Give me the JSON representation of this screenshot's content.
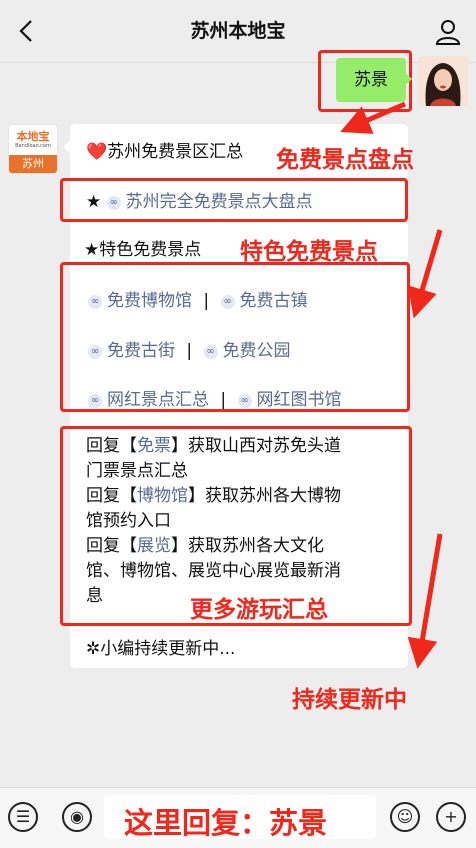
{
  "header": {
    "title": "苏州本地宝"
  },
  "sent_message": {
    "text": "苏景"
  },
  "sender_logo": {
    "brand": "本地宝",
    "site": "Bendibao.com",
    "city": "苏州"
  },
  "bubble": {
    "heart": "❤️",
    "heading": "苏州免费景区汇总",
    "star_link_prefix": "★",
    "star_link": "苏州完全免费景点大盘点",
    "section_heading": "★特色免费景点",
    "links": {
      "museum": "免费博物馆",
      "town": "免费古镇",
      "street": "免费古街",
      "park": "免费公园",
      "scenic": "网红景点汇总",
      "library": "网红图书馆"
    },
    "separator": "|",
    "reply_lines": [
      {
        "prefix": "回复【",
        "keyword": "免票",
        "suffix": "】获取山西对苏免头道",
        "cont": "门票景点汇总"
      },
      {
        "prefix": "回复【",
        "keyword": "博物馆",
        "suffix": "】获取苏州各大博物",
        "cont": "馆预约入口"
      },
      {
        "prefix": "回复【",
        "keyword": "展览",
        "suffix": "】获取苏州各大文化",
        "cont": "馆、博物馆、展览中心展览最新消",
        "cont2": "息"
      }
    ],
    "footer": "✲小编持续更新中..."
  },
  "annotations": {
    "free_spots": "免费景点盘点",
    "featured": "特色免费景点",
    "more_fun": "更多游玩汇总",
    "updating": "持续更新中",
    "reply_here": "这里回复：苏景"
  },
  "colors": {
    "accent_red": "#f0271b",
    "link_blue": "#576b95",
    "sent_bubble": "#95ec69",
    "logo_orange": "#e8712b"
  },
  "icons": [
    "back-icon",
    "person-icon",
    "menu-icon",
    "voice-icon",
    "emoji-icon",
    "plus-icon",
    "link-chain-icon"
  ]
}
